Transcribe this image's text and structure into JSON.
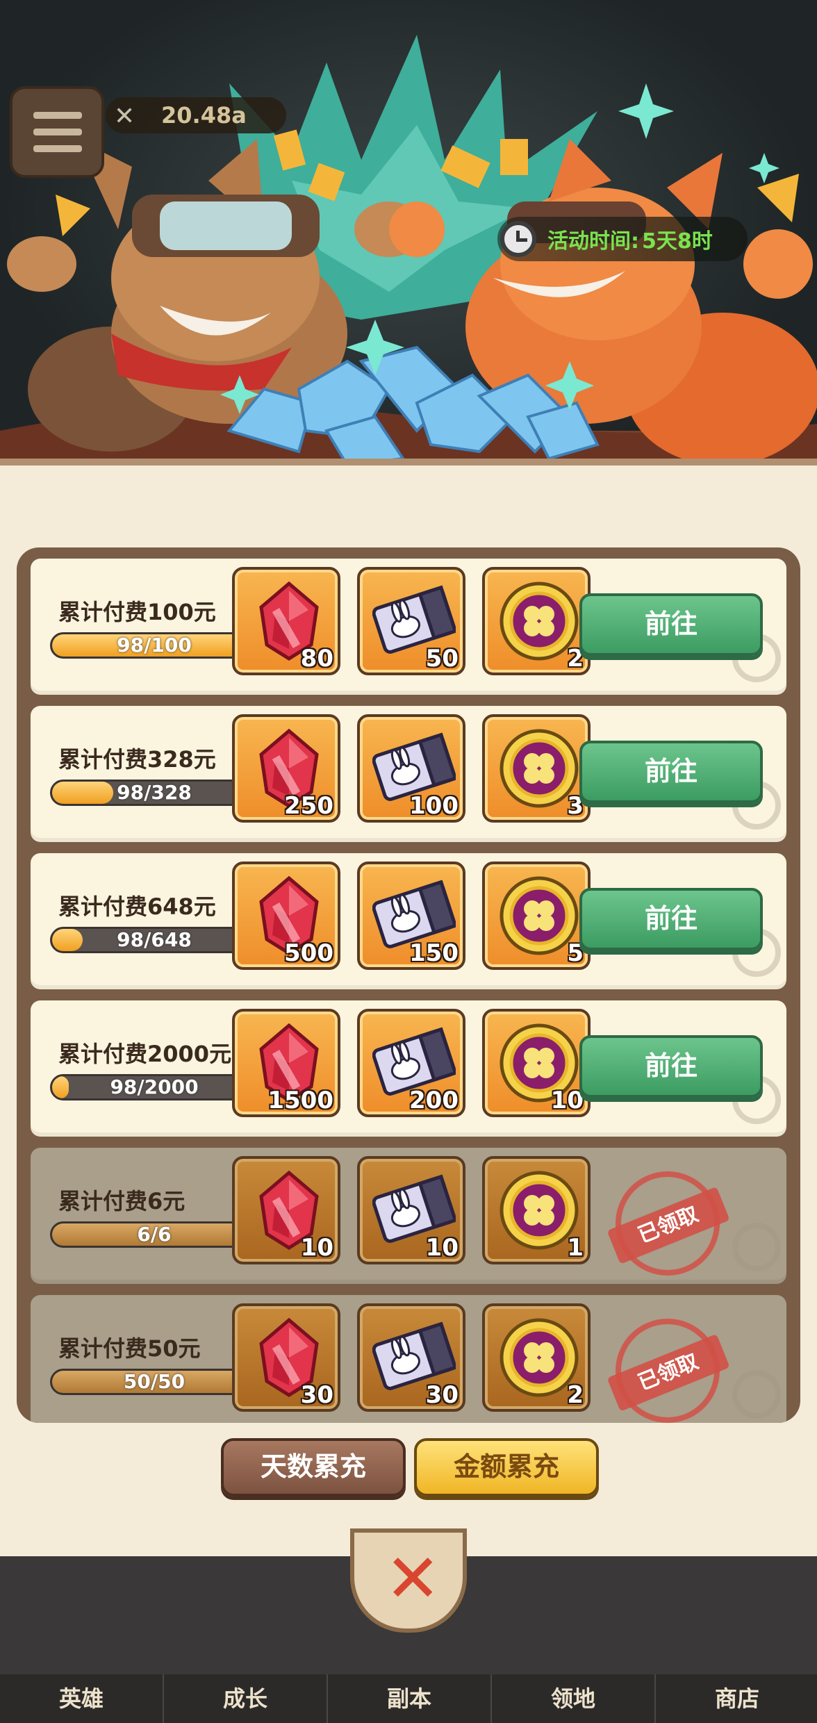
{
  "hud": {
    "power": "20.48a"
  },
  "event": {
    "time_label": "活动时间:",
    "time_value": "5天8时"
  },
  "rows": [
    {
      "title": "累计付费100元",
      "progress_text": "98/100",
      "progress": 0.98,
      "rewards": [
        "80",
        "50",
        "2"
      ],
      "status": "go",
      "button_label": "前往"
    },
    {
      "title": "累计付费328元",
      "progress_text": "98/328",
      "progress": 0.3,
      "rewards": [
        "250",
        "100",
        "3"
      ],
      "status": "go",
      "button_label": "前往"
    },
    {
      "title": "累计付费648元",
      "progress_text": "98/648",
      "progress": 0.15,
      "rewards": [
        "500",
        "150",
        "5"
      ],
      "status": "go",
      "button_label": "前往"
    },
    {
      "title": "累计付费2000元",
      "progress_text": "98/2000",
      "progress": 0.05,
      "rewards": [
        "1500",
        "200",
        "10"
      ],
      "status": "go",
      "button_label": "前往"
    },
    {
      "title": "累计付费6元",
      "progress_text": "6/6",
      "progress": 1.0,
      "rewards": [
        "10",
        "10",
        "1"
      ],
      "status": "claimed",
      "stamp_label": "已领取"
    },
    {
      "title": "累计付费50元",
      "progress_text": "50/50",
      "progress": 1.0,
      "rewards": [
        "30",
        "30",
        "2"
      ],
      "status": "claimed",
      "stamp_label": "已领取"
    }
  ],
  "reward_icons": [
    "red-gem-icon",
    "rabbit-ticket-icon",
    "clover-coin-icon"
  ],
  "tabs": {
    "days": "天数累充",
    "amount": "金额累充",
    "active": "amount"
  },
  "nav": [
    "英雄",
    "成长",
    "副本",
    "领地",
    "商店"
  ],
  "colors": {
    "go_button": "#4fae74",
    "active_tab": "#f4c63a",
    "stamp": "#d25046",
    "timer_text": "#7be34f"
  }
}
